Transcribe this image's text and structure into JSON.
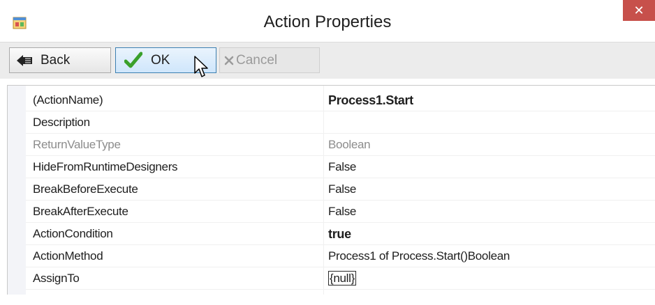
{
  "window": {
    "title": "Action Properties",
    "close_glyph": "✕"
  },
  "toolbar": {
    "back_label": "Back",
    "ok_label": "OK",
    "cancel_label": "Cancel"
  },
  "properties": [
    {
      "name": "(ActionName)",
      "value": "Process1.Start",
      "value_bold": true,
      "disabled": false
    },
    {
      "name": "Description",
      "value": "",
      "value_bold": false,
      "disabled": false
    },
    {
      "name": "ReturnValueType",
      "value": "Boolean",
      "value_bold": false,
      "disabled": true
    },
    {
      "name": "HideFromRuntimeDesigners",
      "value": "False",
      "value_bold": false,
      "disabled": false
    },
    {
      "name": "BreakBeforeExecute",
      "value": "False",
      "value_bold": false,
      "disabled": false
    },
    {
      "name": "BreakAfterExecute",
      "value": "False",
      "value_bold": false,
      "disabled": false
    },
    {
      "name": "ActionCondition",
      "value": "true",
      "value_bold": true,
      "disabled": false
    },
    {
      "name": "ActionMethod",
      "value": "Process1 of Process.Start()Boolean",
      "value_bold": false,
      "disabled": false
    },
    {
      "name": "AssignTo",
      "value": "{null}",
      "value_bold": false,
      "disabled": false
    }
  ],
  "colors": {
    "close_button": "#c7504b",
    "ok_border": "#3c7fb1",
    "check_green": "#3aa02b",
    "disabled_text": "#8c8c8c"
  },
  "icons": {
    "app": "app-window-icon",
    "back": "back-arrow-icon",
    "ok": "green-check-icon",
    "cancel": "gray-x-icon",
    "cursor": "mouse-pointer-icon"
  }
}
